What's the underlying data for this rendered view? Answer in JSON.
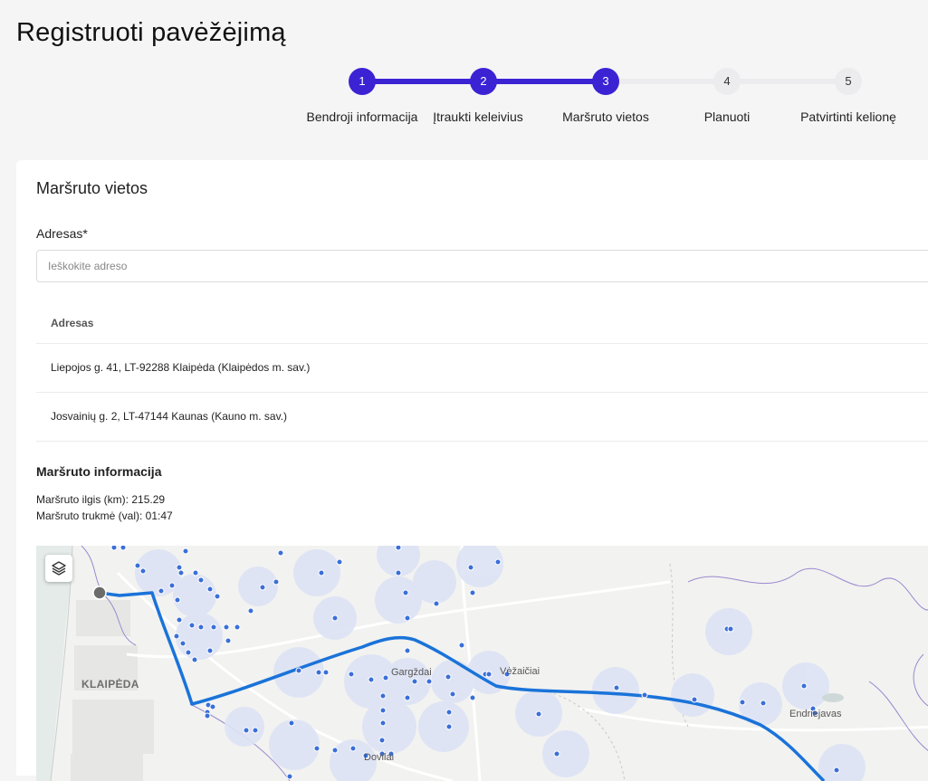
{
  "page": {
    "title": "Registruoti pavėžėjimą"
  },
  "stepper": {
    "steps": [
      {
        "number": "1",
        "label": "Bendroji informacija",
        "state": "done"
      },
      {
        "number": "2",
        "label": "Įtraukti keleivius",
        "state": "done"
      },
      {
        "number": "3",
        "label": "Maršruto vietos",
        "state": "current"
      },
      {
        "number": "4",
        "label": "Planuoti",
        "state": "todo"
      },
      {
        "number": "5",
        "label": "Patvirtinti kelionę",
        "state": "todo"
      }
    ],
    "active_color": "#3b23d4",
    "inactive_color": "#ececee"
  },
  "card": {
    "title": "Maršruto vietos",
    "address_label": "Adresas*",
    "search_placeholder": "Ieškokite adreso",
    "table": {
      "header": "Adresas",
      "rows": [
        "Liepojos g. 41, LT-92288 Klaipėda (Klaipėdos m. sav.)",
        "Josvainių g. 2, LT-47144 Kaunas (Kauno m. sav.)"
      ]
    },
    "route_info": {
      "title": "Maršruto informacija",
      "length": "Maršruto ilgis (km): 215.29",
      "duration": "Maršruto trukmė (val): 01:47"
    }
  },
  "map": {
    "labels": {
      "klaipeda": "KLAIPĖDA",
      "gargzdai": "Gargždai",
      "veivirzenai": "Vėžaičiai",
      "endriejavas": "Endriejavas",
      "dovilai": "Dovilai"
    },
    "layers_icon": "layers-icon",
    "route_color": "#1a73d9",
    "point_color": "#3a6fd8",
    "coverage_color": "#dde3f5"
  }
}
